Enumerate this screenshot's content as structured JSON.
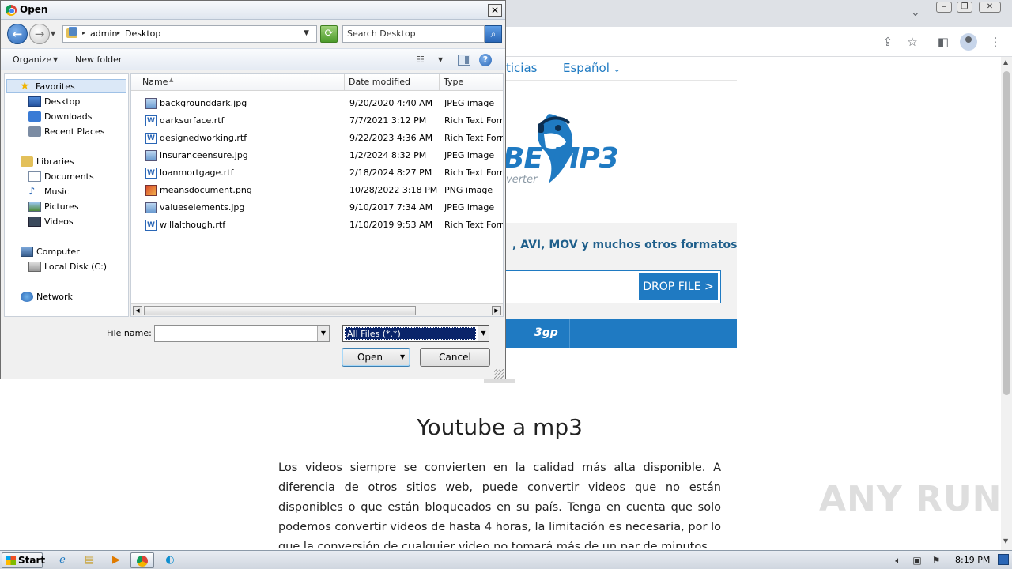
{
  "browser": {
    "nav_links": [
      "ticias",
      "Español"
    ],
    "logo_text": "BE MP3",
    "logo_sub": "verter",
    "formats_text": ", AVI, MOV y muchos otros formatos",
    "drop_button": "DROP FILE >",
    "format_tab": "3gp",
    "heading": "Youtube a mp3",
    "paragraph": "Los videos siempre se convierten en la calidad más alta disponible. A diferencia de otros sitios web, puede convertir videos que no están disponibles o que están bloqueados en su país. Tenga en cuenta que solo podemos convertir videos de hasta 4 horas, la limitación es necesaria, por lo que la conversión de cualquier video no tomará más de un par de minutos.",
    "watermark": "ANY RUN"
  },
  "dialog": {
    "title": "Open",
    "breadcrumb": [
      "admin",
      "Desktop"
    ],
    "search_placeholder": "Search Desktop",
    "toolbar": {
      "organize": "Organize",
      "new_folder": "New folder"
    },
    "nav_items": [
      {
        "label": "Favorites",
        "icon": "star-icon"
      },
      {
        "label": "Desktop",
        "icon": "desktop-icon"
      },
      {
        "label": "Downloads",
        "icon": "downloads-icon"
      },
      {
        "label": "Recent Places",
        "icon": "recent-places-icon"
      },
      {
        "label": "Libraries",
        "icon": "libraries-icon"
      },
      {
        "label": "Documents",
        "icon": "documents-icon"
      },
      {
        "label": "Music",
        "icon": "music-icon"
      },
      {
        "label": "Pictures",
        "icon": "pictures-icon"
      },
      {
        "label": "Videos",
        "icon": "videos-icon"
      },
      {
        "label": "Computer",
        "icon": "computer-icon"
      },
      {
        "label": "Local Disk (C:)",
        "icon": "local-disk-icon"
      },
      {
        "label": "Network",
        "icon": "network-icon"
      }
    ],
    "columns": [
      "Name",
      "Date modified",
      "Type"
    ],
    "files": [
      {
        "name": "backgrounddark.jpg",
        "date": "9/20/2020 4:40 AM",
        "type": "JPEG image",
        "kind": "jpg"
      },
      {
        "name": "darksurface.rtf",
        "date": "7/7/2021 3:12 PM",
        "type": "Rich Text Format",
        "kind": "rtf"
      },
      {
        "name": "designedworking.rtf",
        "date": "9/22/2023 4:36 AM",
        "type": "Rich Text Format",
        "kind": "rtf"
      },
      {
        "name": "insuranceensure.jpg",
        "date": "1/2/2024 8:32 PM",
        "type": "JPEG image",
        "kind": "jpg"
      },
      {
        "name": "loanmortgage.rtf",
        "date": "2/18/2024 8:27 PM",
        "type": "Rich Text Format",
        "kind": "rtf"
      },
      {
        "name": "meansdocument.png",
        "date": "10/28/2022 3:18 PM",
        "type": "PNG image",
        "kind": "png"
      },
      {
        "name": "valueselements.jpg",
        "date": "9/10/2017 7:34 AM",
        "type": "JPEG image",
        "kind": "jpg"
      },
      {
        "name": "willalthough.rtf",
        "date": "1/10/2019 9:53 AM",
        "type": "Rich Text Format",
        "kind": "rtf"
      }
    ],
    "file_name_label": "File name:",
    "file_name_value": "",
    "file_type_value": "All Files (*.*)",
    "open_button": "Open",
    "cancel_button": "Cancel"
  },
  "taskbar": {
    "start_label": "Start",
    "clock": "8:19 PM"
  }
}
